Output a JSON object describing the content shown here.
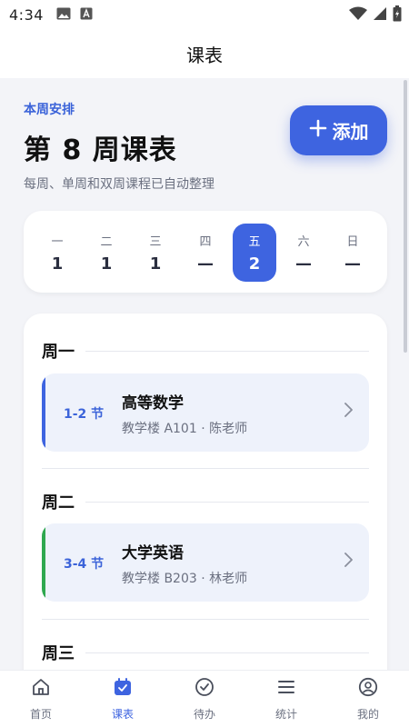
{
  "status_bar": {
    "time": "4:34"
  },
  "app_bar": {
    "title": "课表"
  },
  "header": {
    "eyebrow": "本周安排",
    "title": "第 8 周课表",
    "subtitle": "每周、单周和双周课程已自动整理",
    "add_button_label": "添加"
  },
  "week_days": [
    {
      "name": "一",
      "value": "1",
      "active": false
    },
    {
      "name": "二",
      "value": "1",
      "active": false
    },
    {
      "name": "三",
      "value": "1",
      "active": false
    },
    {
      "name": "四",
      "value": "—",
      "active": false
    },
    {
      "name": "五",
      "value": "2",
      "active": true
    },
    {
      "name": "六",
      "value": "—",
      "active": false
    },
    {
      "name": "日",
      "value": "—",
      "active": false
    }
  ],
  "sections": [
    {
      "title": "周一",
      "course": {
        "period": "1-2 节",
        "name": "高等数学",
        "meta": "教学楼 A101 · 陈老师",
        "color": "#3e64e0"
      }
    },
    {
      "title": "周二",
      "course": {
        "period": "3-4 节",
        "name": "大学英语",
        "meta": "教学楼 B203 · 林老师",
        "color": "#2fa84f"
      }
    },
    {
      "title": "周三"
    }
  ],
  "tabs": [
    {
      "label": "首页",
      "icon": "home-icon",
      "active": false
    },
    {
      "label": "课表",
      "icon": "calendar-icon",
      "active": true
    },
    {
      "label": "待办",
      "icon": "check-circle-icon",
      "active": false
    },
    {
      "label": "统计",
      "icon": "menu-lines-icon",
      "active": false
    },
    {
      "label": "我的",
      "icon": "profile-icon",
      "active": false
    }
  ],
  "colors": {
    "accent": "#3e64e0",
    "green": "#2fa84f"
  }
}
